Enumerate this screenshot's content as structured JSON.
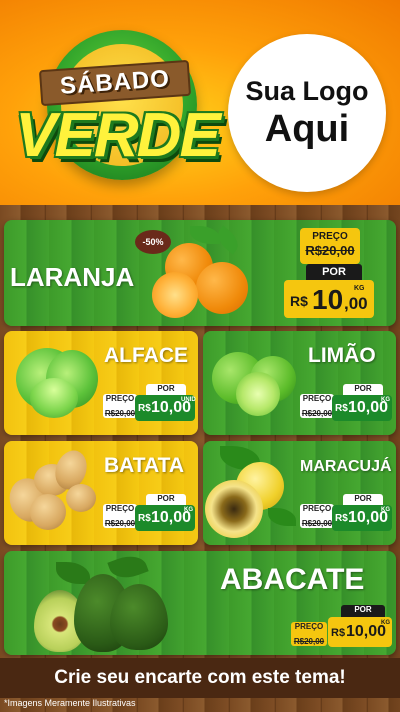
{
  "header": {
    "badge_top": "SÁBADO",
    "badge_main": "VERDE",
    "logo_line1": "Sua Logo",
    "logo_line2": "Aqui"
  },
  "products": {
    "laranja": {
      "name": "LARANJA",
      "discount": "-50%",
      "preco_label": "PREÇO",
      "old_price": "R$20,00",
      "por_label": "POR",
      "currency": "R$",
      "price_int": "10",
      "price_dec": ",00",
      "unit": "KG"
    },
    "alface": {
      "name": "ALFACE",
      "preco_label": "PREÇO",
      "old_price": "R$20,00",
      "por_label": "POR",
      "currency": "R$",
      "price": "10,00",
      "unit": "UNID"
    },
    "limao": {
      "name": "LIMÃO",
      "preco_label": "PREÇO",
      "old_price": "R$20,00",
      "por_label": "POR",
      "currency": "R$",
      "price": "10,00",
      "unit": "KG"
    },
    "batata": {
      "name": "BATATA",
      "preco_label": "PREÇO",
      "old_price": "R$20,00",
      "por_label": "POR",
      "currency": "R$",
      "price": "10,00",
      "unit": "KG"
    },
    "maracuja": {
      "name": "MARACUJÁ",
      "preco_label": "PREÇO",
      "old_price": "R$20,00",
      "por_label": "POR",
      "currency": "R$",
      "price": "10,00",
      "unit": "KG"
    },
    "abacate": {
      "name": "ABACATE",
      "preco_label": "PREÇO",
      "old_price": "R$20,00",
      "por_label": "POR",
      "currency": "R$",
      "price": "10,00",
      "unit": "KG"
    }
  },
  "footer": {
    "cta": "Crie seu encarte com este tema!",
    "disclaimer": "*Imagens Meramente Ilustrativas"
  },
  "colors": {
    "green": "#3d9b2a",
    "yellow": "#f2c20f",
    "orange": "#f07a00",
    "wood": "#7a4a22"
  }
}
